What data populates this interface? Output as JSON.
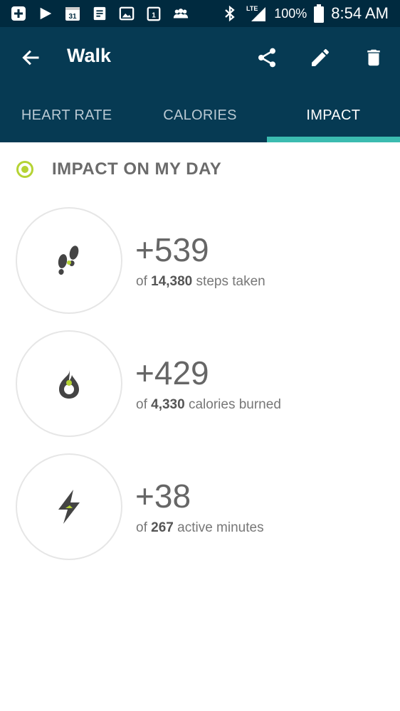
{
  "status_bar": {
    "battery": "100%",
    "time": "8:54 AM",
    "network": "LTE"
  },
  "app_bar": {
    "title": "Walk",
    "icons": [
      "back-arrow-icon",
      "share-icon",
      "edit-pencil-icon",
      "delete-trash-icon"
    ]
  },
  "tabs": [
    {
      "label": "HEART RATE",
      "active": false
    },
    {
      "label": "CALORIES",
      "active": false
    },
    {
      "label": "IMPACT",
      "active": true
    }
  ],
  "section": {
    "title": "IMPACT ON MY DAY"
  },
  "impacts": [
    {
      "icon": "footsteps-icon",
      "delta": "+539",
      "prefix": "of",
      "total": "14,380",
      "suffix": "steps taken"
    },
    {
      "icon": "flame-icon",
      "delta": "+429",
      "prefix": "of",
      "total": "4,330",
      "suffix": "calories burned"
    },
    {
      "icon": "lightning-bolt-icon",
      "delta": "+38",
      "prefix": "of",
      "total": "267",
      "suffix": "active minutes"
    }
  ],
  "colors": {
    "status_bar": "#002a3f",
    "app_bar": "#063a53",
    "tab_indicator": "#3bbbb0",
    "accent_lime": "#b5d334",
    "icon_dark": "#444444"
  }
}
